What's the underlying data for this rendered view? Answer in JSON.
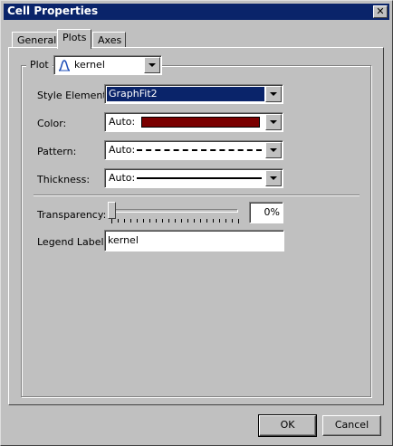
{
  "window": {
    "title": "Cell Properties",
    "close_glyph": "✕"
  },
  "tabs": [
    {
      "label": "General",
      "active": false
    },
    {
      "label": "Plots",
      "active": true
    },
    {
      "label": "Axes",
      "active": false
    }
  ],
  "plot": {
    "label": "Plot",
    "selected": "kernel",
    "icon": "kernel-density-icon"
  },
  "style_element": {
    "label": "Style Element:",
    "value": "GraphFit2"
  },
  "color": {
    "label": "Color:",
    "value": "Auto:",
    "swatch": "#7a0000"
  },
  "pattern": {
    "label": "Pattern:",
    "value": "Auto:",
    "line_style": "dashed"
  },
  "thickness": {
    "label": "Thickness:",
    "value": "Auto:",
    "line_style": "solid"
  },
  "transparency": {
    "label": "Transparency:",
    "value": "0%",
    "level": 0
  },
  "legend_label": {
    "label": "Legend Label:",
    "value": "kernel"
  },
  "buttons": {
    "ok": "OK",
    "cancel": "Cancel"
  },
  "colors": {
    "title_bar": "#0a246a",
    "face": "#c0c0c0",
    "selection": "#0a246a"
  }
}
